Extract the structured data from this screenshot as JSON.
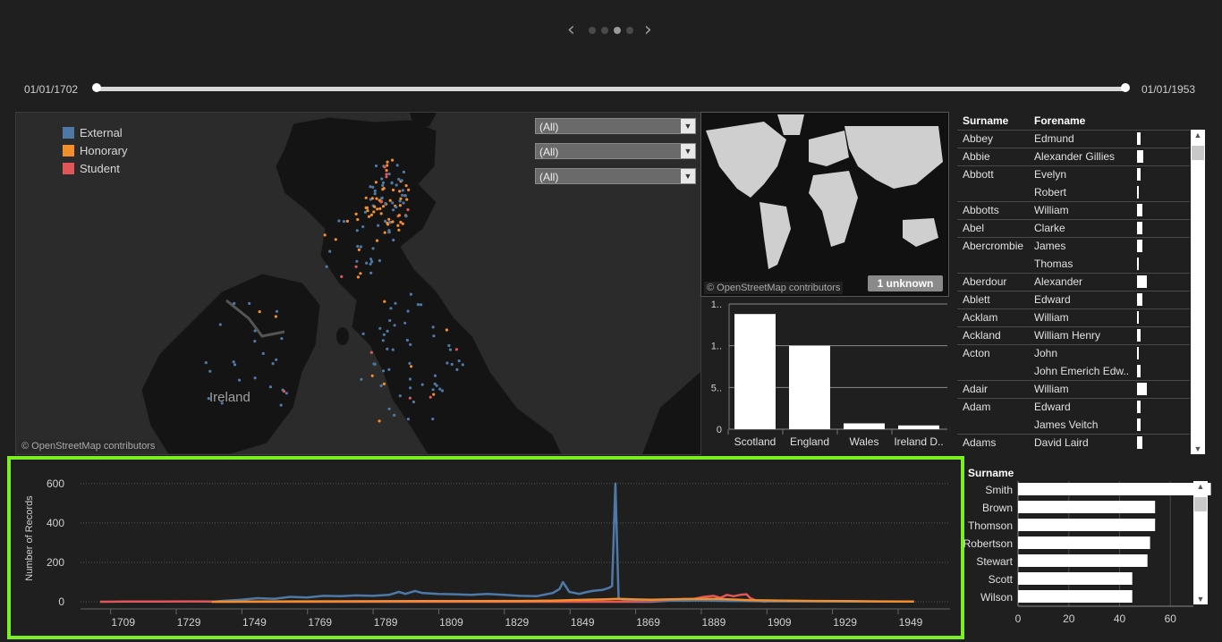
{
  "pager": {
    "prev": "‹",
    "next": "›",
    "dots": 4,
    "active_dot": 2
  },
  "date_range": {
    "start": "01/01/1702",
    "end": "01/01/1953"
  },
  "map": {
    "legend": [
      {
        "label": "External",
        "color": "#4e79a7"
      },
      {
        "label": "Honorary",
        "color": "#f28e2b"
      },
      {
        "label": "Student",
        "color": "#e15759"
      }
    ],
    "filters": [
      "(All)",
      "(All)",
      "(All)"
    ],
    "place_label": "Ireland",
    "credit": "© OpenStreetMap contributors"
  },
  "world_map": {
    "credit": "© OpenStreetMap contributors",
    "unknown_badge": "1 unknown"
  },
  "country_chart": {
    "type": "bar",
    "categories": [
      "Scotland",
      "England",
      "Wales",
      "Ireland D.."
    ],
    "values": [
      1380,
      1000,
      70,
      45
    ],
    "tick_labels": [
      "0",
      "5..",
      "1..",
      "1.."
    ],
    "tick_values": [
      0,
      500,
      1000,
      1500
    ]
  },
  "name_table": {
    "headers": {
      "surname": "Surname",
      "forename": "Forename"
    },
    "rows": [
      {
        "surname": "Abbey",
        "forename": "Edmund",
        "value": 2
      },
      {
        "surname": "Abbie",
        "forename": "Alexander Gillies",
        "value": 4
      },
      {
        "surname": "Abbott",
        "forename": "Evelyn",
        "value": 2
      },
      {
        "surname": "",
        "forename": "Robert",
        "value": 1
      },
      {
        "surname": "Abbotts",
        "forename": "William",
        "value": 3
      },
      {
        "surname": "Abel",
        "forename": "Clarke",
        "value": 3
      },
      {
        "surname": "Abercrombie",
        "forename": "James",
        "value": 3
      },
      {
        "surname": "",
        "forename": "Thomas",
        "value": 1
      },
      {
        "surname": "Aberdour",
        "forename": "Alexander",
        "value": 6
      },
      {
        "surname": "Ablett",
        "forename": "Edward",
        "value": 3
      },
      {
        "surname": "Acklam",
        "forename": "William",
        "value": 1
      },
      {
        "surname": "Ackland",
        "forename": "William Henry",
        "value": 2
      },
      {
        "surname": "Acton",
        "forename": "John",
        "value": 1
      },
      {
        "surname": "",
        "forename": "John Emerich Edw..",
        "value": 2
      },
      {
        "surname": "Adair",
        "forename": "William",
        "value": 6
      },
      {
        "surname": "Adam",
        "forename": "Edward",
        "value": 2
      },
      {
        "surname": "",
        "forename": "James Veitch",
        "value": 2
      },
      {
        "surname": "Adams",
        "forename": "David Laird",
        "value": 3
      }
    ]
  },
  "timeline_chart": {
    "type": "line",
    "ylabel": "Number of Records",
    "y_ticks": [
      0,
      200,
      400,
      600
    ],
    "x_ticks": [
      1709,
      1729,
      1749,
      1769,
      1789,
      1809,
      1829,
      1849,
      1869,
      1889,
      1909,
      1929,
      1949
    ],
    "xlim": [
      1696,
      1961
    ],
    "ylim": [
      0,
      640
    ],
    "series": [
      {
        "name": "Student",
        "color": "#e15759",
        "x": [
          1702,
          1710,
          1720,
          1730,
          1736,
          1740,
          1870,
          1875,
          1880,
          1883,
          1886,
          1889,
          1891,
          1893,
          1895,
          1897,
          1899,
          1900,
          1902,
          1905
        ],
        "y": [
          0,
          1,
          1,
          2,
          1,
          0,
          0,
          5,
          8,
          15,
          25,
          30,
          20,
          35,
          28,
          35,
          38,
          20,
          5,
          0
        ]
      },
      {
        "name": "External",
        "color": "#4e79a7",
        "x": [
          1736,
          1740,
          1745,
          1750,
          1755,
          1760,
          1765,
          1770,
          1775,
          1780,
          1785,
          1790,
          1793,
          1795,
          1798,
          1800,
          1805,
          1810,
          1815,
          1820,
          1825,
          1830,
          1835,
          1840,
          1842,
          1843,
          1845,
          1848,
          1850,
          1852,
          1855,
          1857,
          1858,
          1859,
          1860,
          1862,
          1865,
          1870,
          1875,
          1880,
          1885,
          1890,
          1895,
          1900,
          1905,
          1910,
          1915,
          1920,
          1930,
          1940,
          1950
        ],
        "y": [
          0,
          5,
          10,
          18,
          15,
          25,
          22,
          30,
          28,
          32,
          30,
          35,
          50,
          40,
          55,
          45,
          40,
          38,
          35,
          40,
          35,
          30,
          28,
          45,
          65,
          100,
          50,
          40,
          48,
          55,
          60,
          70,
          80,
          600,
          15,
          10,
          8,
          5,
          6,
          5,
          7,
          5,
          4,
          3,
          2,
          2,
          2,
          2,
          1,
          1,
          1
        ]
      },
      {
        "name": "Honorary",
        "color": "#f28e2b",
        "x": [
          1736,
          1760,
          1800,
          1830,
          1840,
          1850,
          1855,
          1860,
          1865,
          1870,
          1880,
          1890,
          1900,
          1910,
          1920,
          1930,
          1940,
          1950
        ],
        "y": [
          0,
          2,
          3,
          4,
          6,
          10,
          12,
          15,
          12,
          10,
          14,
          15,
          8,
          6,
          4,
          3,
          2,
          1
        ]
      }
    ]
  },
  "surname_chart": {
    "type": "bar",
    "header": "Surname",
    "categories": [
      "Smith",
      "Brown",
      "Thomson",
      "Robertson",
      "Stewart",
      "Scott",
      "Wilson"
    ],
    "values": [
      76,
      54,
      54,
      52,
      51,
      45,
      45
    ],
    "x_ticks": [
      0,
      20,
      40,
      60
    ],
    "xlim": [
      0,
      80
    ]
  }
}
